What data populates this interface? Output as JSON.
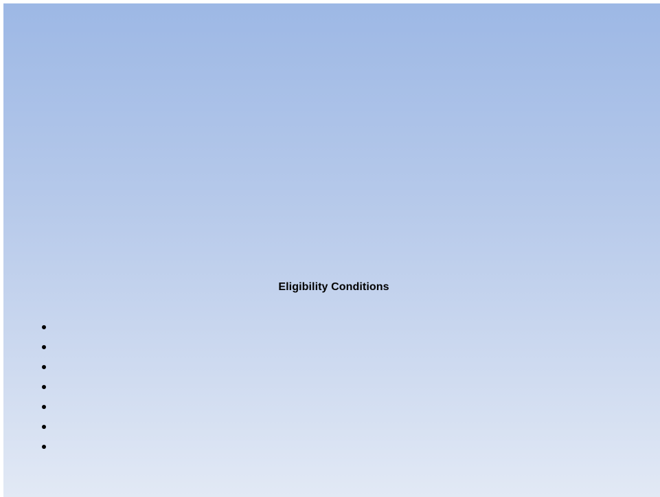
{
  "slide": {
    "title": "Eligibility Conditions",
    "bullets": [
      "",
      "",
      "",
      "",
      "",
      "",
      ""
    ]
  }
}
